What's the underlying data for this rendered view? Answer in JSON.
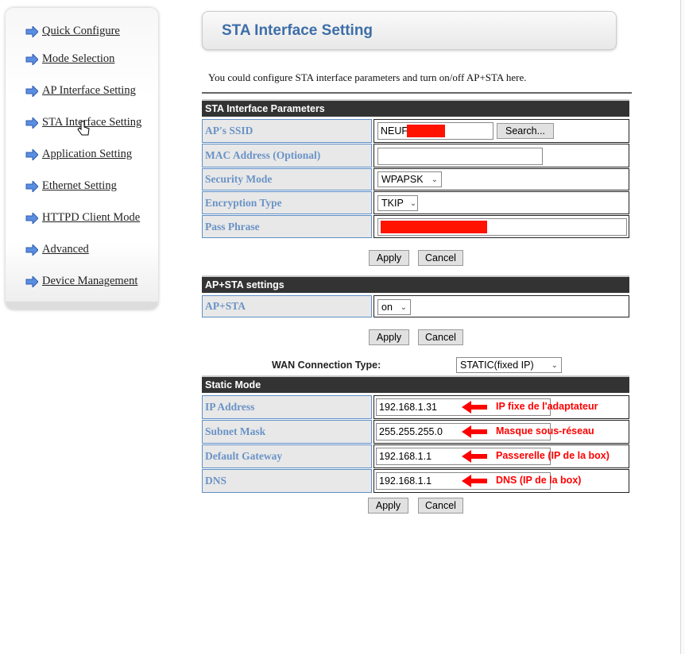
{
  "sidebar": {
    "items": [
      {
        "label": "Quick Configure"
      },
      {
        "label": "Mode Selection"
      },
      {
        "label": "AP Interface Setting"
      },
      {
        "label": "STA Interface Setting"
      },
      {
        "label": "Application Setting"
      },
      {
        "label": "Ethernet Setting"
      },
      {
        "label": "HTTPD Client Mode"
      },
      {
        "label": "Advanced"
      },
      {
        "label": "Device Management"
      }
    ]
  },
  "page": {
    "title": "STA Interface Setting",
    "description": "You could configure STA interface parameters and turn on/off AP+STA here."
  },
  "sta_params": {
    "header": "STA Interface Parameters",
    "ssid_label": "AP's SSID",
    "ssid_value": "NEUF_",
    "search_button": "Search...",
    "mac_label": "MAC Address (Optional)",
    "mac_value": "",
    "security_label": "Security Mode",
    "security_value": "WPAPSK",
    "encryption_label": "Encryption Type",
    "encryption_value": "TKIP",
    "passphrase_label": "Pass Phrase",
    "apply": "Apply",
    "cancel": "Cancel"
  },
  "apsta": {
    "header": "AP+STA settings",
    "label": "AP+STA",
    "value": "on",
    "apply": "Apply",
    "cancel": "Cancel"
  },
  "wan": {
    "label": "WAN Connection Type:",
    "value": "STATIC(fixed IP)"
  },
  "static": {
    "header": "Static Mode",
    "rows": [
      {
        "label": "IP Address",
        "value": "192.168.1.31",
        "note": "IP fixe de l'adaptateur"
      },
      {
        "label": "Subnet Mask",
        "value": "255.255.255.0",
        "note": "Masque sous-réseau"
      },
      {
        "label": "Default Gateway",
        "value": "192.168.1.1",
        "note": "Passerelle (IP de la box)"
      },
      {
        "label": "DNS",
        "value": "192.168.1.1",
        "note": "DNS (IP de la box)"
      }
    ],
    "apply": "Apply",
    "cancel": "Cancel"
  },
  "colors": {
    "accent": "#3d6ea8",
    "label": "#6a93c6",
    "annotation": "#ff0000",
    "header": "#333333"
  }
}
